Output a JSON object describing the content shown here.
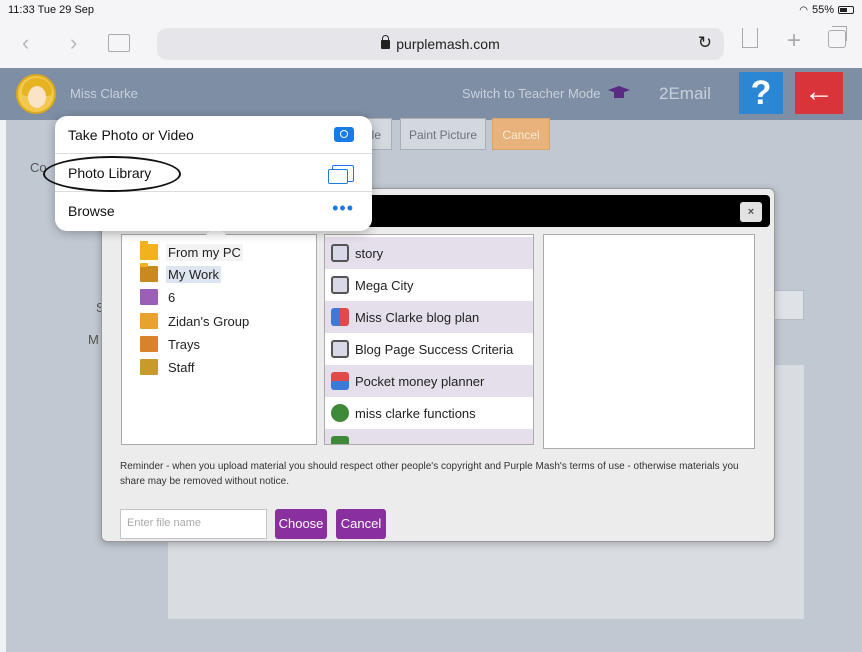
{
  "status_bar": {
    "time": "11:33",
    "date": "Tue 29 Sep",
    "battery": "55%"
  },
  "browser": {
    "url": "purplemash.com",
    "back_icon": "chevron-left",
    "forward_icon": "chevron-right"
  },
  "header": {
    "user_name": "Miss Clarke",
    "switch_mode": "Switch to Teacher Mode",
    "app_name": "2Email",
    "help_label": "?",
    "back_label": "←"
  },
  "toolbar": {
    "file_label": "ile",
    "paint_label": "Paint Picture",
    "cancel_label": "Cancel"
  },
  "page_fragments": {
    "co": "Co",
    "s": "S",
    "m": "M"
  },
  "popover": {
    "items": [
      {
        "label": "Take Photo or Video",
        "icon": "camera-icon"
      },
      {
        "label": "Photo Library",
        "icon": "photo-library-icon"
      },
      {
        "label": "Browse",
        "icon": "more-icon"
      }
    ]
  },
  "dialog": {
    "close_label": "×",
    "folders": [
      "From my PC",
      "My Work",
      "6",
      "Zidan's Group",
      "Trays",
      "Staff"
    ],
    "files": [
      "story",
      "Mega City",
      "Miss Clarke blog plan",
      "Blog Page Success Criteria",
      "Pocket money planner",
      "miss clarke functions"
    ],
    "reminder": "Reminder - when you upload material you should respect other people's copyright and Purple Mash's terms of use - otherwise materials you share may be removed without notice.",
    "filename_placeholder": "Enter file name",
    "choose_label": "Choose",
    "cancel_label": "Cancel"
  },
  "colors": {
    "header": "#7e8ea5",
    "purple": "#8a2fa0",
    "help": "#2b87d4",
    "back": "#d9343a",
    "ios_blue": "#1a7ae8"
  }
}
